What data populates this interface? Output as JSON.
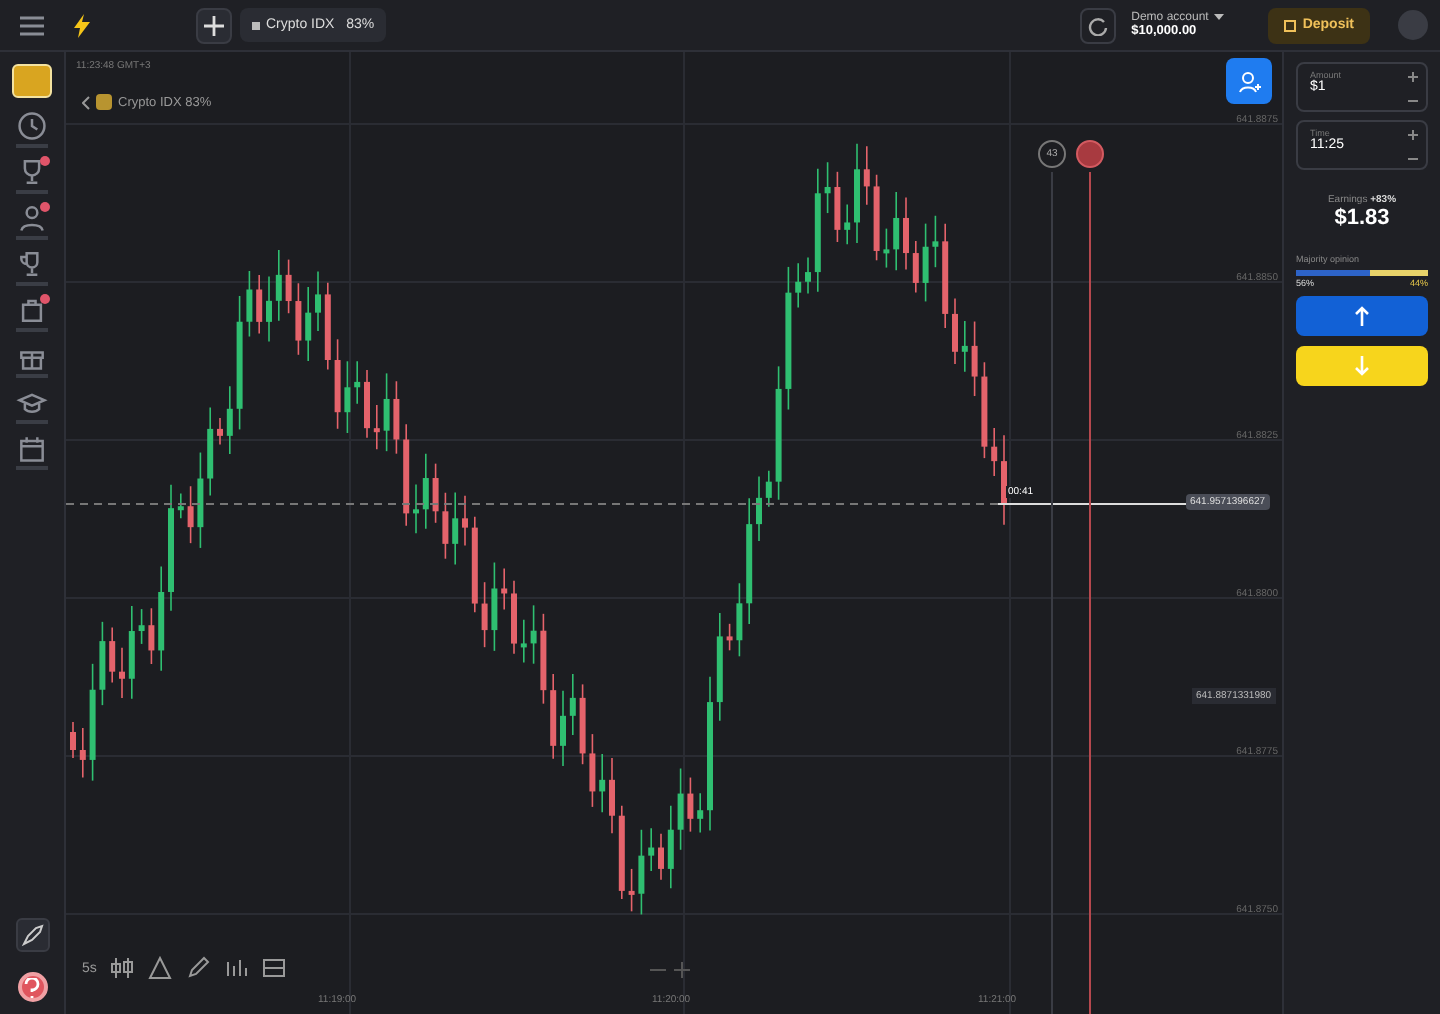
{
  "top_bar": {
    "asset_tab": {
      "label": "Crypto IDX",
      "payout": "83%"
    },
    "account": {
      "label": "Demo account",
      "balance": "$10,000.00"
    },
    "deposit_button": "Deposit"
  },
  "sidebar": {
    "items": [
      {
        "dot": false
      },
      {
        "dot": true
      },
      {
        "dot": true
      },
      {
        "dot": false
      },
      {
        "dot": true
      },
      {
        "dot": false
      },
      {
        "dot": false
      },
      {
        "dot": false
      }
    ]
  },
  "chart": {
    "clock": "11:23:48 GMT+3",
    "asset_label": "Crypto IDX 83%",
    "price_ticks": [
      "641.8875",
      "641.8850",
      "641.8825",
      "641.8800",
      "641.8775",
      "641.8750"
    ],
    "current_price": "641.9571396627",
    "strike_price": "641.8871331980",
    "countdown": "00:41",
    "marker": "43",
    "time_labels": [
      "11:19:00",
      "11:20:00",
      "11:21:00"
    ],
    "toolbar": {
      "timeframe": "5s"
    }
  },
  "trade_panel": {
    "amount": {
      "label": "Amount",
      "value": "$1"
    },
    "time": {
      "label": "Time",
      "value": "11:25"
    },
    "earnings_label": "Earnings",
    "earnings_pct": "+83%",
    "earnings": "$1.83",
    "sentiment": {
      "label": "Majority opinion",
      "level": 0.56,
      "up": "56%",
      "down": "44%"
    }
  }
}
